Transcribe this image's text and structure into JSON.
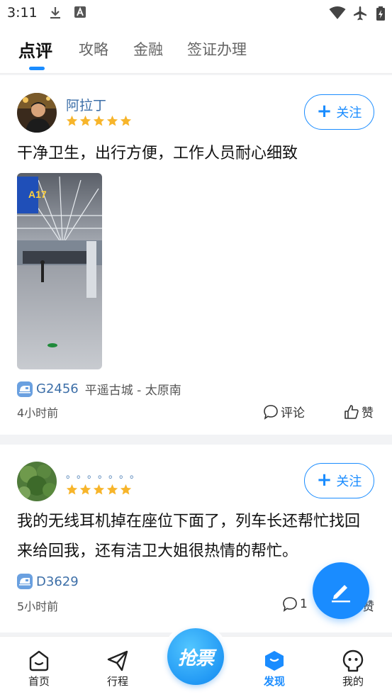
{
  "status_bar": {
    "time": "3:11"
  },
  "tabs": [
    {
      "label": "点评"
    },
    {
      "label": "攻略"
    },
    {
      "label": "金融"
    },
    {
      "label": "签证办理"
    }
  ],
  "posts": [
    {
      "username": "阿拉丁",
      "rating": 5,
      "follow_label": "关注",
      "text": "干净卫生，出行方便，工作人员耐心细致",
      "train_no": "G2456",
      "route": "平遥古城 - 太原南",
      "time_ago": "4小时前",
      "comment_label": "评论",
      "like_label": "赞"
    },
    {
      "username": "。。。。。。。",
      "rating": 5,
      "follow_label": "关注",
      "text": "我的无线耳机掉在座位下面了，列车长还帮忙找回来给回我，还有洁卫大姐很热情的帮忙。",
      "train_no": "D3629",
      "time_ago": "5小时前",
      "comment_count": "1",
      "like_label": "赞"
    }
  ],
  "bottom_nav": {
    "items": [
      {
        "label": "首页"
      },
      {
        "label": "行程"
      },
      {
        "label": "发现"
      },
      {
        "label": "我的"
      }
    ],
    "center_label": "抢票"
  },
  "colors": {
    "accent": "#1a8cff",
    "star": "#f7b52b",
    "username": "#3d6fa8"
  }
}
